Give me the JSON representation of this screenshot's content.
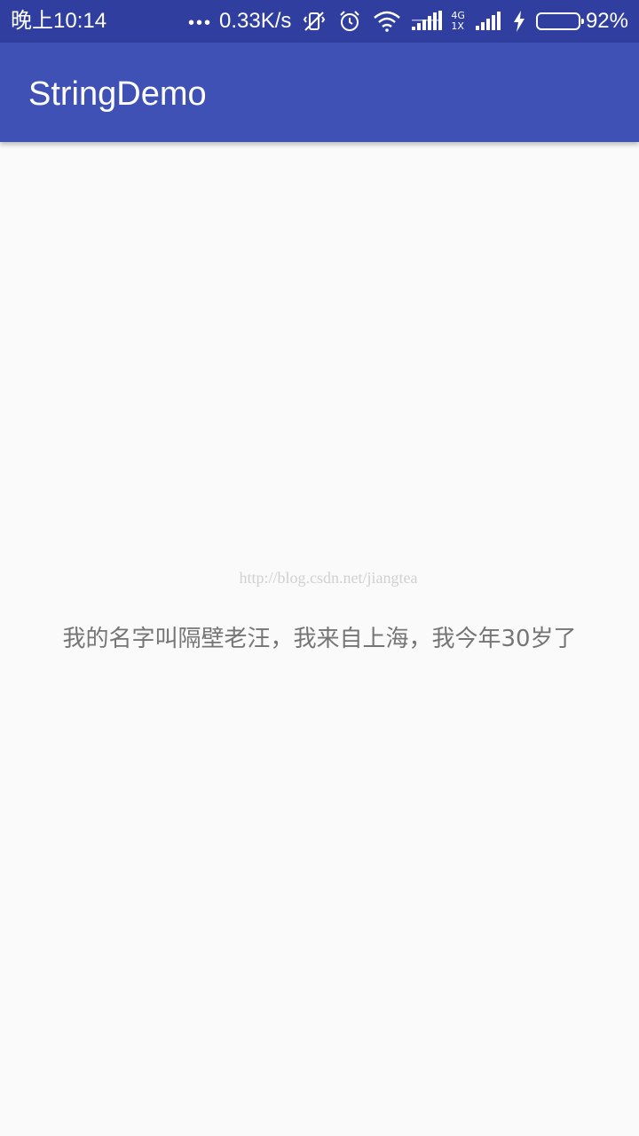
{
  "status_bar": {
    "time": "晚上10:14",
    "dots": "•••",
    "net_speed": "0.33K/s",
    "net_type_top": "4G",
    "net_type_bottom": "1X",
    "battery_percent": "92%",
    "battery_level": 0.92,
    "battery_color": "#4cd200",
    "icons": [
      "vibrate-off-icon",
      "alarm-icon",
      "wifi-icon",
      "signal-4g-icon",
      "signal-icon",
      "charging-icon",
      "battery-icon"
    ]
  },
  "app_bar": {
    "title": "StringDemo",
    "color": "#3f51b5"
  },
  "watermark": {
    "text": "http://blog.csdn.net/jiangtea"
  },
  "main": {
    "text": "我的名字叫隔壁老汪，我来自上海，我今年30岁了"
  }
}
